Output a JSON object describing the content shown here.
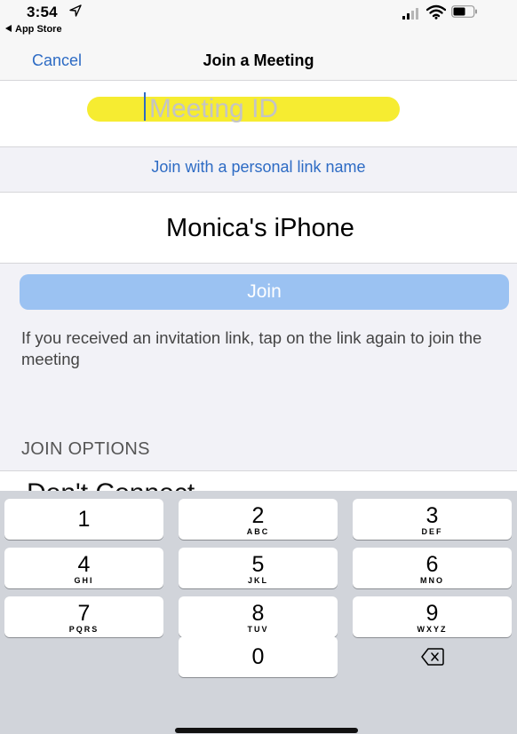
{
  "status_bar": {
    "time": "3:54",
    "back_app": "App Store",
    "icons": [
      "location-arrow-icon",
      "cellular-signal-icon",
      "wifi-icon",
      "battery-icon"
    ]
  },
  "nav": {
    "cancel_label": "Cancel",
    "title": "Join a Meeting"
  },
  "meeting_id": {
    "placeholder": "Meeting ID",
    "value": "",
    "highlight_color": "#f5ea1f"
  },
  "personal_link": {
    "label": "Join with a personal link name"
  },
  "name_field": {
    "value": "Monica's iPhone"
  },
  "join_button": {
    "label": "Join",
    "color": "#9bc2f2"
  },
  "info_text": "If you received an invitation link, tap on the link again to join the meeting",
  "join_options": {
    "header": "JOIN OPTIONS",
    "first_option": "Don't Connect"
  },
  "keypad": {
    "keys": [
      {
        "digit": "1",
        "letters": ""
      },
      {
        "digit": "2",
        "letters": "ABC"
      },
      {
        "digit": "3",
        "letters": "DEF"
      },
      {
        "digit": "4",
        "letters": "GHI"
      },
      {
        "digit": "5",
        "letters": "JKL"
      },
      {
        "digit": "6",
        "letters": "MNO"
      },
      {
        "digit": "7",
        "letters": "PQRS"
      },
      {
        "digit": "8",
        "letters": "TUV"
      },
      {
        "digit": "9",
        "letters": "WXYZ"
      },
      {
        "digit": "0",
        "letters": ""
      }
    ],
    "delete_icon": "backspace-icon"
  },
  "colors": {
    "accent": "#2d6bc4"
  }
}
